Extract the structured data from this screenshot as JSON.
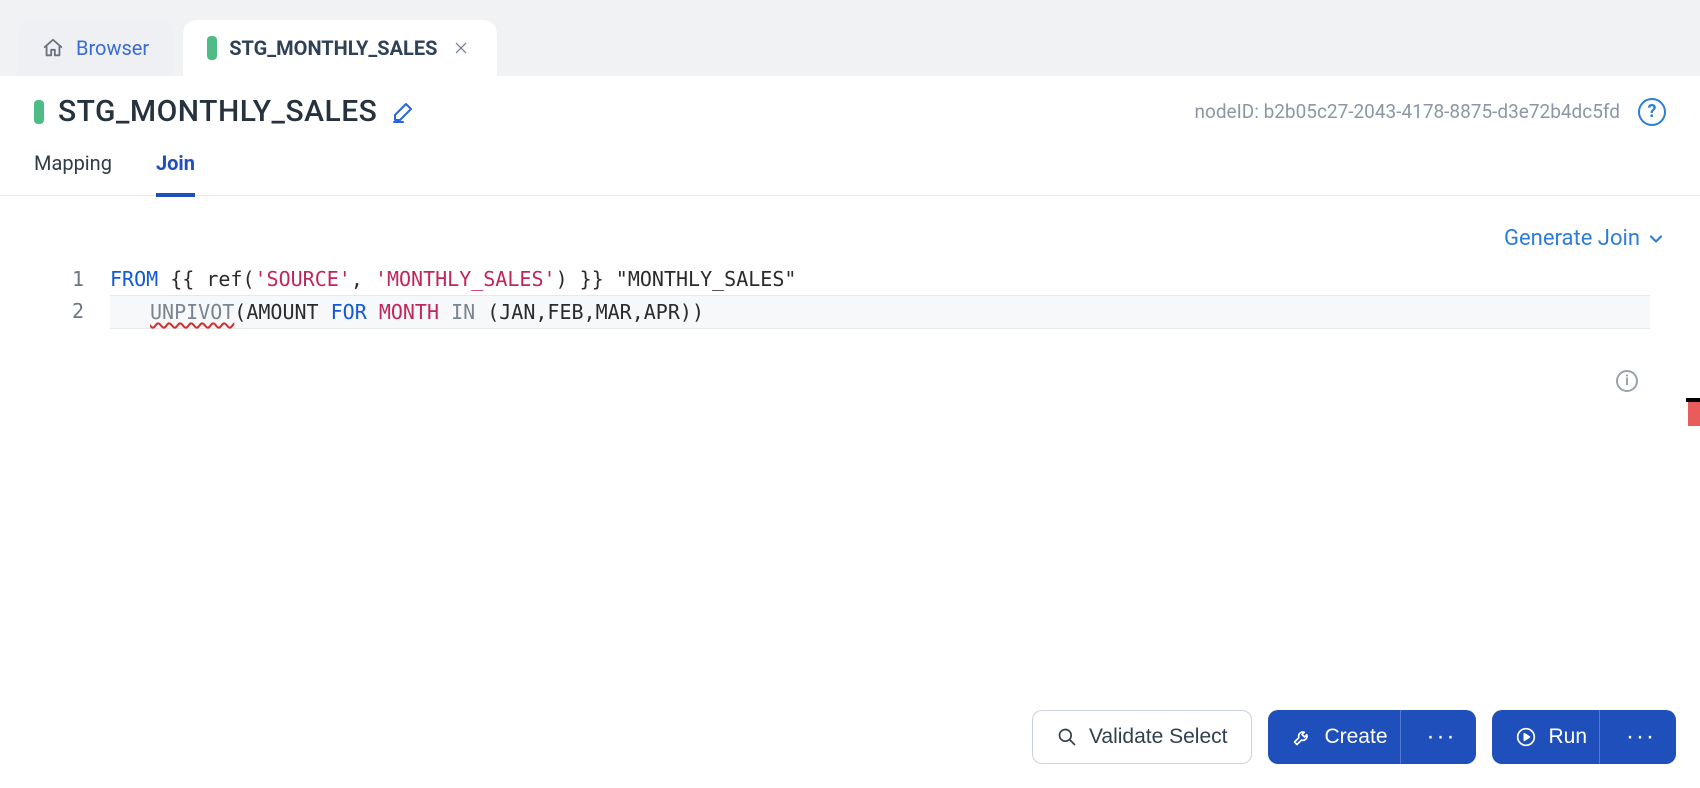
{
  "tabs": {
    "browser_label": "Browser",
    "active_label": "STG_MONTHLY_SALES"
  },
  "title": {
    "text": "STG_MONTHLY_SALES",
    "node_id_label": "nodeID: b2b05c27-2043-4178-8875-d3e72b4dc5fd"
  },
  "subtabs": {
    "mapping": "Mapping",
    "join": "Join"
  },
  "generate_join_label": "Generate Join",
  "code": {
    "line_numbers": [
      "1",
      "2"
    ],
    "l1": {
      "from": "FROM",
      "open_tmpl": " {{ ",
      "ref": "ref",
      "open_paren": "(",
      "arg1": "'SOURCE'",
      "comma": ", ",
      "arg2": "'MONTHLY_SALES'",
      "close_paren": ")",
      "close_tmpl": " }} ",
      "alias": "\"MONTHLY_SALES\""
    },
    "l2": {
      "unpivot": "UNPIVOT",
      "open": "(",
      "amount": "AMOUNT",
      "sp1": " ",
      "for": "FOR",
      "sp2": " ",
      "month": "MONTH",
      "sp3": " ",
      "inkw": "IN",
      "sp4": " ",
      "cols_open": "(",
      "cols": "JAN,FEB,MAR,APR",
      "cols_close": ")",
      "close": ")"
    }
  },
  "footer": {
    "validate_label": "Validate Select",
    "create_label": "Create",
    "run_label": "Run"
  }
}
